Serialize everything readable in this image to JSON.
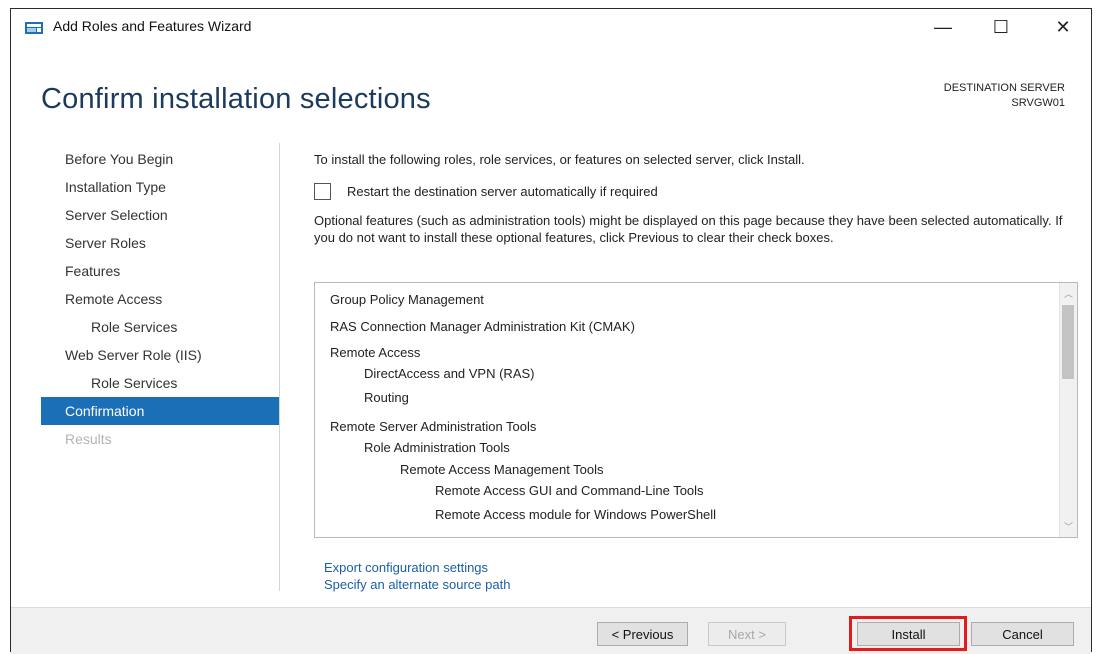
{
  "window": {
    "title": "Add Roles and Features Wizard",
    "minimize_glyph": "—",
    "maximize_glyph": "☐",
    "close_glyph": "✕"
  },
  "header": {
    "title": "Confirm installation selections",
    "destination_label": "DESTINATION SERVER",
    "destination_server": "SRVGW01"
  },
  "nav": {
    "items": [
      {
        "label": "Before You Begin",
        "state": "normal"
      },
      {
        "label": "Installation Type",
        "state": "normal"
      },
      {
        "label": "Server Selection",
        "state": "normal"
      },
      {
        "label": "Server Roles",
        "state": "normal"
      },
      {
        "label": "Features",
        "state": "normal"
      },
      {
        "label": "Remote Access",
        "state": "normal"
      },
      {
        "label": "Role Services",
        "state": "normal"
      },
      {
        "label": "Web Server Role (IIS)",
        "state": "normal"
      },
      {
        "label": "Role Services",
        "state": "normal"
      },
      {
        "label": "Confirmation",
        "state": "active"
      },
      {
        "label": "Results",
        "state": "disabled"
      }
    ]
  },
  "content": {
    "intro": "To install the following roles, role services, or features on selected server, click Install.",
    "restart_label": "Restart the destination server automatically if required",
    "restart_checked": false,
    "optional_text": "Optional features (such as administration tools) might be displayed on this page because they have been selected automatically. If you do not want to install these optional features, click Previous to clear their check boxes.",
    "selections": [
      {
        "text": "Group Policy Management",
        "level": 0
      },
      {
        "text": "RAS Connection Manager Administration Kit (CMAK)",
        "level": 0
      },
      {
        "text": "Remote Access",
        "level": 0
      },
      {
        "text": "DirectAccess and VPN (RAS)",
        "level": 1
      },
      {
        "text": "Routing",
        "level": 1
      },
      {
        "text": "Remote Server Administration Tools",
        "level": 0
      },
      {
        "text": "Role Administration Tools",
        "level": 1
      },
      {
        "text": "Remote Access Management Tools",
        "level": 2
      },
      {
        "text": "Remote Access GUI and Command-Line Tools",
        "level": 3
      },
      {
        "text": "Remote Access module for Windows PowerShell",
        "level": 3
      }
    ],
    "scroll_up_glyph": "︿",
    "scroll_down_glyph": "﹀",
    "export_link": "Export configuration settings",
    "alternate_link": "Specify an alternate source path"
  },
  "footer": {
    "previous_label": "< Previous",
    "next_label": "Next >",
    "install_label": "Install",
    "cancel_label": "Cancel",
    "highlight_color": "#e21c1c"
  }
}
